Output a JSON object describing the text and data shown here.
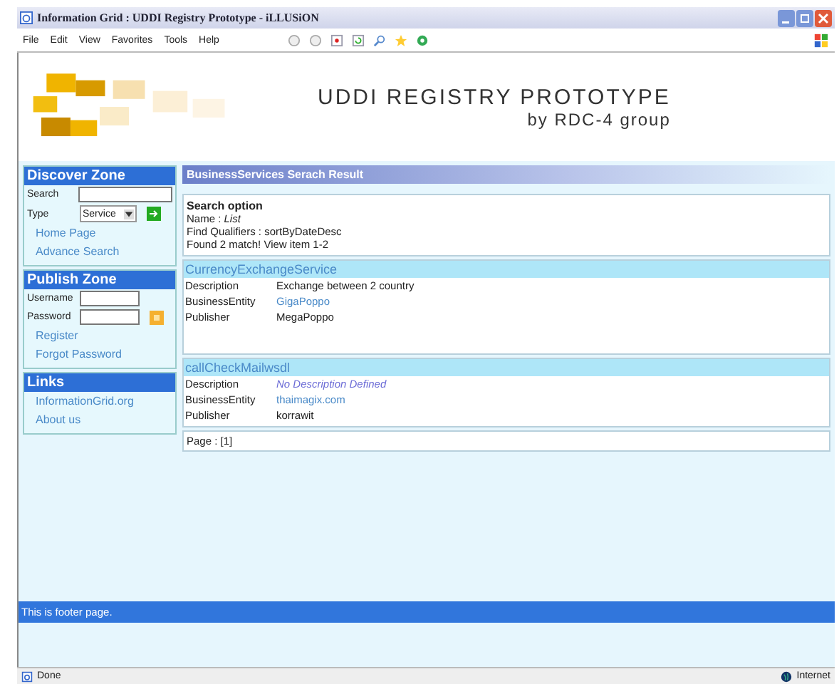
{
  "window": {
    "title": "Information Grid : UDDI Registry Prototype - iLLUSiON"
  },
  "menu": [
    "File",
    "Edit",
    "View",
    "Favorites",
    "Tools",
    "Help"
  ],
  "header": {
    "title": "UDDI REGISTRY PROTOTYPE",
    "subtitle": "by RDC-4 group"
  },
  "sidebar": {
    "discover": {
      "title": "Discover Zone",
      "search_label": "Search",
      "type_label": "Type",
      "type_value": "Service",
      "links": [
        "Home Page",
        "Advance Search"
      ]
    },
    "publish": {
      "title": "Publish Zone",
      "username_label": "Username",
      "password_label": "Password",
      "links": [
        "Register",
        "Forgot Password"
      ]
    },
    "links": {
      "title": "Links",
      "items": [
        "InformationGrid.org",
        "About us"
      ]
    }
  },
  "main": {
    "heading": "BusinessServices Serach Result",
    "search_option": {
      "title": "Search option",
      "lines": [
        "Name : *List*",
        "Find Qualifiers : sortByDateDesc",
        "Found 2 match! View item 1-2"
      ]
    },
    "services": [
      {
        "name": "CurrencyExchangeService",
        "fields": [
          {
            "label": "Description",
            "value": "Exchange between 2 country",
            "kind": "text"
          },
          {
            "label": "BusinessEntity",
            "value": "GigaPoppo",
            "kind": "link"
          },
          {
            "label": "Publisher",
            "value": "MegaPoppo",
            "kind": "text"
          }
        ]
      },
      {
        "name": "callCheckMailwsdl",
        "fields": [
          {
            "label": "Description",
            "value": "No Description Defined",
            "kind": "empty"
          },
          {
            "label": "BusinessEntity",
            "value": "thaimagix.com",
            "kind": "link"
          },
          {
            "label": "Publisher",
            "value": "korrawit",
            "kind": "text"
          }
        ]
      }
    ],
    "page": "Page : [1]"
  },
  "footer": "This is footer page.",
  "status": {
    "left": "Done",
    "right": "Internet"
  }
}
